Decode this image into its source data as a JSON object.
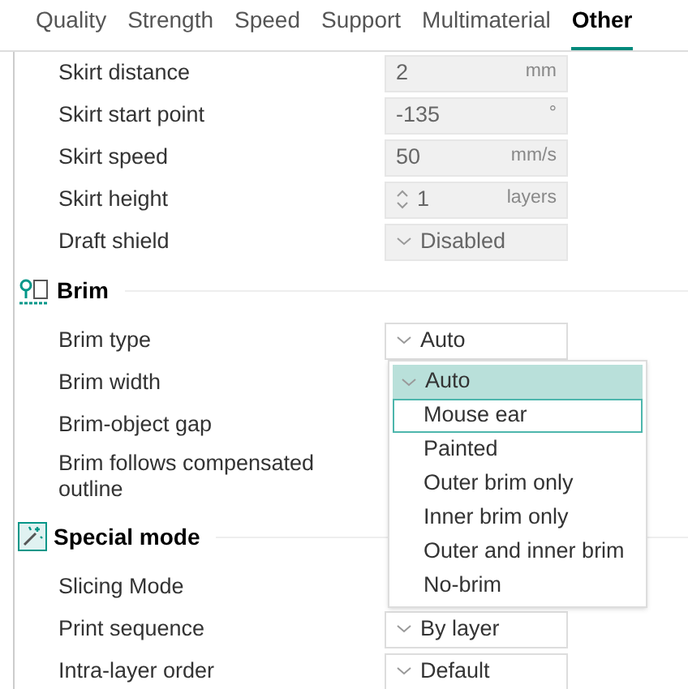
{
  "tabs": [
    {
      "label": "Quality",
      "selected": false
    },
    {
      "label": "Strength",
      "selected": false
    },
    {
      "label": "Speed",
      "selected": false
    },
    {
      "label": "Support",
      "selected": false
    },
    {
      "label": "Multimaterial",
      "selected": false
    },
    {
      "label": "Other",
      "selected": true
    }
  ],
  "sections": [
    {
      "rows": [
        {
          "label": "Skirt distance",
          "field": {
            "kind": "input",
            "value": "2",
            "unit": "mm",
            "disabled": true
          }
        },
        {
          "label": "Skirt start point",
          "field": {
            "kind": "input",
            "value": "-135",
            "unit": "°",
            "disabled": true
          }
        },
        {
          "label": "Skirt speed",
          "field": {
            "kind": "input",
            "value": "50",
            "unit": "mm/s",
            "disabled": true
          }
        },
        {
          "label": "Skirt height",
          "field": {
            "kind": "spin",
            "value": "1",
            "unit": "layers",
            "disabled": true
          }
        },
        {
          "label": "Draft shield",
          "field": {
            "kind": "select",
            "value": "Disabled",
            "disabled": true
          }
        }
      ]
    },
    {
      "title": "Brim",
      "kind": "brim",
      "rows": [
        {
          "label": "Brim type",
          "field": {
            "kind": "select",
            "value": "Auto",
            "disabled": false
          }
        },
        {
          "label": "Brim width"
        },
        {
          "label": "Brim-object gap"
        },
        {
          "label": "Brim follows compensated outline"
        }
      ]
    },
    {
      "title": "Special mode",
      "kind": "special",
      "rows": [
        {
          "label": "Slicing Mode"
        },
        {
          "label": "Print sequence",
          "field": {
            "kind": "select",
            "value": "By layer",
            "disabled": false
          }
        },
        {
          "label": "Intra-layer order",
          "field": {
            "kind": "select",
            "value": "Default",
            "disabled": false
          }
        }
      ]
    }
  ],
  "dropdown": {
    "options": [
      {
        "label": "Auto",
        "selected": true,
        "hovered": false
      },
      {
        "label": "Mouse ear",
        "selected": false,
        "hovered": true
      },
      {
        "label": "Painted",
        "selected": false,
        "hovered": false
      },
      {
        "label": "Outer brim only",
        "selected": false,
        "hovered": false
      },
      {
        "label": "Inner brim only",
        "selected": false,
        "hovered": false
      },
      {
        "label": "Outer and inner brim",
        "selected": false,
        "hovered": false
      },
      {
        "label": "No-brim",
        "selected": false,
        "hovered": false
      }
    ]
  }
}
